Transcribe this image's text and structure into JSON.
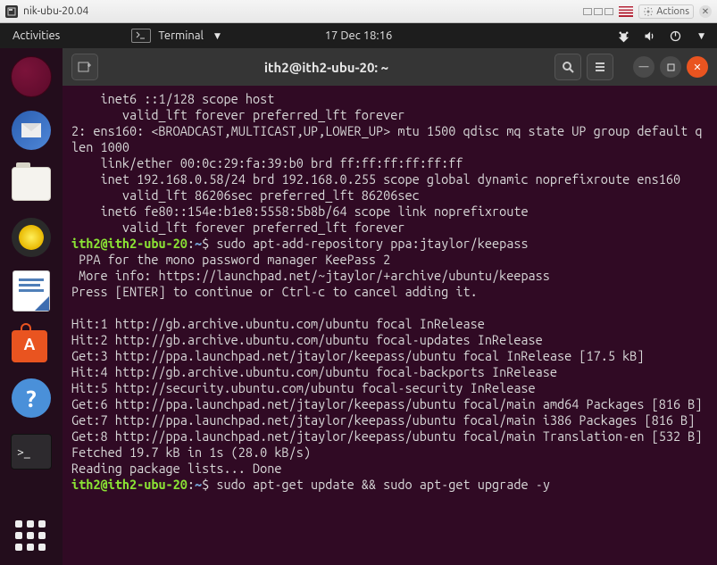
{
  "vm": {
    "title": "nik-ubu-20.04",
    "actions_label": "Actions"
  },
  "panel": {
    "activities": "Activities",
    "app_name": "Terminal",
    "datetime": "17 Dec  18:16"
  },
  "terminal": {
    "title": "ith2@ith2-ubu-20: ~",
    "prompt_user": "ith2@ith2-ubu-20",
    "prompt_sep": ":",
    "prompt_path": "~",
    "prompt_end": "$",
    "cmd1": "sudo apt-add-repository ppa:jtaylor/keepass",
    "cmd2": "sudo apt-get update && sudo apt-get upgrade -y",
    "lines": {
      "l01": "    inet6 ::1/128 scope host ",
      "l02": "       valid_lft forever preferred_lft forever",
      "l03": "2: ens160: <BROADCAST,MULTICAST,UP,LOWER_UP> mtu 1500 qdisc mq state UP group default qlen 1000",
      "l04": "    link/ether 00:0c:29:fa:39:b0 brd ff:ff:ff:ff:ff:ff",
      "l05": "    inet 192.168.0.58/24 brd 192.168.0.255 scope global dynamic noprefixroute ens160",
      "l06": "       valid_lft 86206sec preferred_lft 86206sec",
      "l07": "    inet6 fe80::154e:b1e8:5558:5b8b/64 scope link noprefixroute ",
      "l08": "       valid_lft forever preferred_lft forever",
      "l09": " PPA for the mono password manager KeePass 2",
      "l10": " More info: https://launchpad.net/~jtaylor/+archive/ubuntu/keepass",
      "l11": "Press [ENTER] to continue or Ctrl-c to cancel adding it.",
      "l12": "",
      "l13": "Hit:1 http://gb.archive.ubuntu.com/ubuntu focal InRelease",
      "l14": "Hit:2 http://gb.archive.ubuntu.com/ubuntu focal-updates InRelease",
      "l15": "Get:3 http://ppa.launchpad.net/jtaylor/keepass/ubuntu focal InRelease [17.5 kB]",
      "l16": "Hit:4 http://gb.archive.ubuntu.com/ubuntu focal-backports InRelease",
      "l17": "Hit:5 http://security.ubuntu.com/ubuntu focal-security InRelease",
      "l18": "Get:6 http://ppa.launchpad.net/jtaylor/keepass/ubuntu focal/main amd64 Packages [816 B]",
      "l19": "Get:7 http://ppa.launchpad.net/jtaylor/keepass/ubuntu focal/main i386 Packages [816 B]",
      "l20": "Get:8 http://ppa.launchpad.net/jtaylor/keepass/ubuntu focal/main Translation-en [532 B]",
      "l21": "Fetched 19.7 kB in 1s (28.0 kB/s)",
      "l22": "Reading package lists... Done"
    }
  }
}
